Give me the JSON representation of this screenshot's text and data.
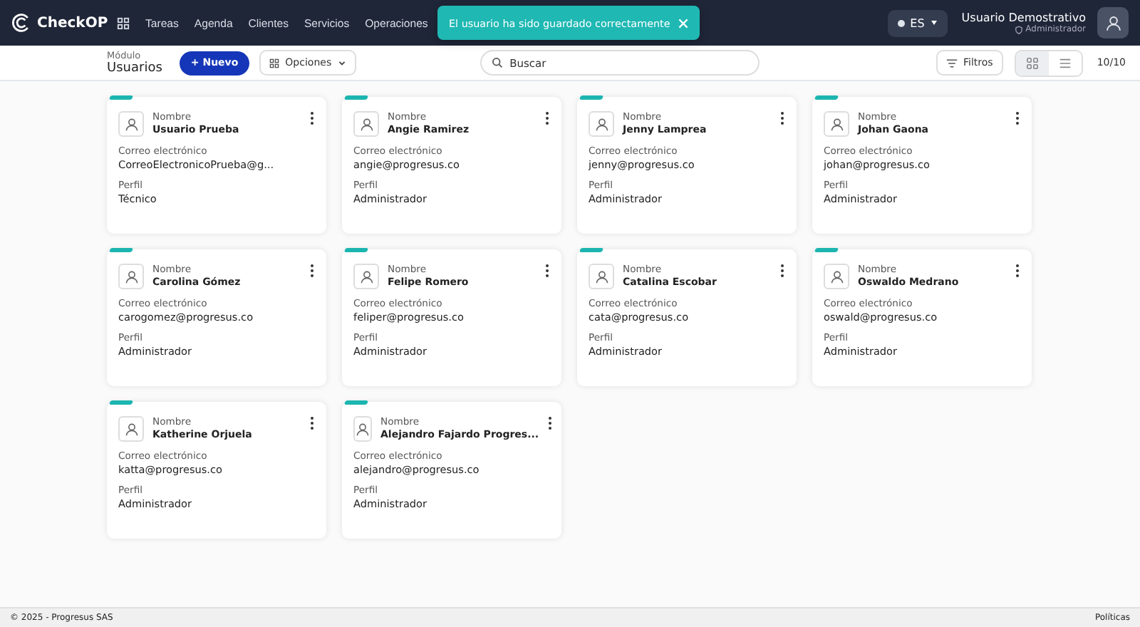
{
  "navbar": {
    "brand": "CheckOP",
    "menu": [
      {
        "label": "Tareas"
      },
      {
        "label": "Agenda"
      },
      {
        "label": "Clientes"
      },
      {
        "label": "Servicios"
      },
      {
        "label": "Operaciones"
      }
    ],
    "language": "ES",
    "user": {
      "name": "Usuario Demostrativo",
      "role": "Administrador"
    }
  },
  "toast": {
    "message": "El usuario ha sido guardado correctamente"
  },
  "toolbar": {
    "module_label": "Módulo",
    "module_name": "Usuarios",
    "new_button": "+ Nuevo",
    "options_button": "Opciones",
    "search": {
      "placeholder": "Buscar"
    },
    "filters_button": "Filtros",
    "views": [
      {
        "kind": "grid",
        "selected": true
      },
      {
        "kind": "list",
        "selected": false
      }
    ],
    "count": "10/10"
  },
  "cards": [
    {
      "name_label": "Nombre",
      "name": "Usuario Prueba",
      "email_label": "Correo electrónico",
      "email": "CorreoElectronicoPrueba@g...",
      "profile_label": "Perfil",
      "profile": "Técnico"
    },
    {
      "name_label": "Nombre",
      "name": "Angie Ramirez",
      "email_label": "Correo electrónico",
      "email": "angie@progresus.co",
      "profile_label": "Perfil",
      "profile": "Administrador"
    },
    {
      "name_label": "Nombre",
      "name": "Jenny Lamprea",
      "email_label": "Correo electrónico",
      "email": "jenny@progresus.co",
      "profile_label": "Perfil",
      "profile": "Administrador"
    },
    {
      "name_label": "Nombre",
      "name": "Johan Gaona",
      "email_label": "Correo electrónico",
      "email": "johan@progresus.co",
      "profile_label": "Perfil",
      "profile": "Administrador"
    },
    {
      "name_label": "Nombre",
      "name": "Carolina Gómez",
      "email_label": "Correo electrónico",
      "email": "carogomez@progresus.co",
      "profile_label": "Perfil",
      "profile": "Administrador"
    },
    {
      "name_label": "Nombre",
      "name": "Felipe Romero",
      "email_label": "Correo electrónico",
      "email": "feliper@progresus.co",
      "profile_label": "Perfil",
      "profile": "Administrador"
    },
    {
      "name_label": "Nombre",
      "name": "Catalina Escobar",
      "email_label": "Correo electrónico",
      "email": "cata@progresus.co",
      "profile_label": "Perfil",
      "profile": "Administrador"
    },
    {
      "name_label": "Nombre",
      "name": "Oswaldo Medrano",
      "email_label": "Correo electrónico",
      "email": "oswald@progresus.co",
      "profile_label": "Perfil",
      "profile": "Administrador"
    },
    {
      "name_label": "Nombre",
      "name": "Katherine Orjuela",
      "email_label": "Correo electrónico",
      "email": "katta@progresus.co",
      "profile_label": "Perfil",
      "profile": "Administrador"
    },
    {
      "name_label": "Nombre",
      "name": "Alejandro Fajardo Progres...",
      "email_label": "Correo electrónico",
      "email": "alejandro@progresus.co",
      "profile_label": "Perfil",
      "profile": "Administrador"
    }
  ],
  "footer": {
    "copyright": "© 2025 - Progresus SAS",
    "link": "Políticas"
  }
}
